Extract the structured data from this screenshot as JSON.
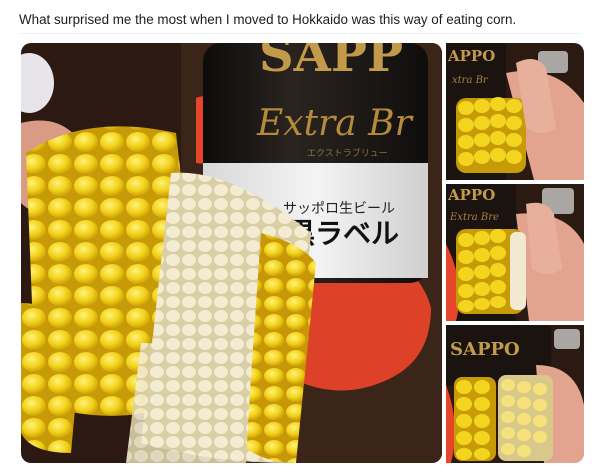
{
  "tweet": {
    "text": "What surprised me the most when I moved to Hokkaido was this way of eating corn."
  },
  "photos": {
    "main": {
      "bottle_brand": "SAPP",
      "bottle_script": "Extra Br",
      "bottle_katakana_small": "エクストラブリュー",
      "bottle_japanese_line1": "サッポロ生ビール",
      "bottle_japanese_line2": "黒ラベル"
    },
    "p1": {
      "bottle_brand": "APPO",
      "bottle_script": "xtra Br"
    },
    "p2": {
      "bottle_brand": "APPO",
      "bottle_script": "Extra Bre"
    },
    "p3": {
      "bottle_brand": "SAPPO"
    }
  },
  "colors": {
    "kernel_yellow": "#f2d21a",
    "kernel_pale": "#f1ead0",
    "bottle_dark": "#1b1714",
    "label_gold": "#b48b3a",
    "coaster_red": "#e6452a",
    "table_brown": "#3a2418"
  }
}
